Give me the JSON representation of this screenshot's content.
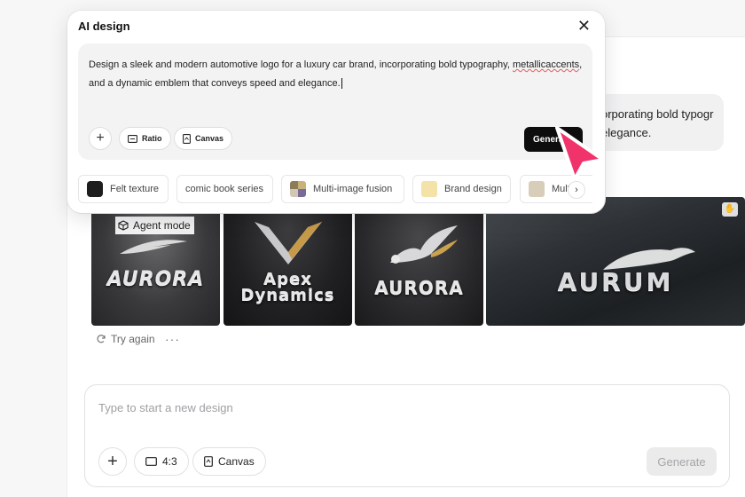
{
  "background": {
    "bubble_line1": "orporating bold typogr",
    "bubble_line2": "elegance."
  },
  "results": {
    "agent_mode": "Agent mode",
    "images": [
      {
        "brand": "AURORA"
      },
      {
        "brand_line1": "Apex",
        "brand_line2": "Dynamics"
      },
      {
        "brand": "AURORA"
      },
      {
        "brand": "AURUM"
      }
    ],
    "try_again": "Try again",
    "more": "···"
  },
  "composer": {
    "placeholder": "Type to start a new design",
    "ratio_label": "4:3",
    "canvas_label": "Canvas",
    "generate_label": "Generate"
  },
  "dialog": {
    "title": "AI design",
    "prompt_part1": "Design a sleek and modern automotive logo for a luxury car brand, incorporating bold typography, ",
    "prompt_misspelled": "metallicaccents",
    "prompt_part2": ",",
    "prompt_part3": "and a dynamic emblem that conveys speed and elegance.",
    "ratio_label": "Ratio",
    "canvas_label": "Canvas",
    "generate_label": "Generate",
    "styles": [
      {
        "label": "Felt texture"
      },
      {
        "label": "comic book series"
      },
      {
        "label": "Multi-image fusion"
      },
      {
        "label": "Brand design"
      },
      {
        "label": "Multi"
      }
    ]
  },
  "colors": {
    "accent_cursor": "#f0336b",
    "generate_dark": "#0d0d0d"
  }
}
